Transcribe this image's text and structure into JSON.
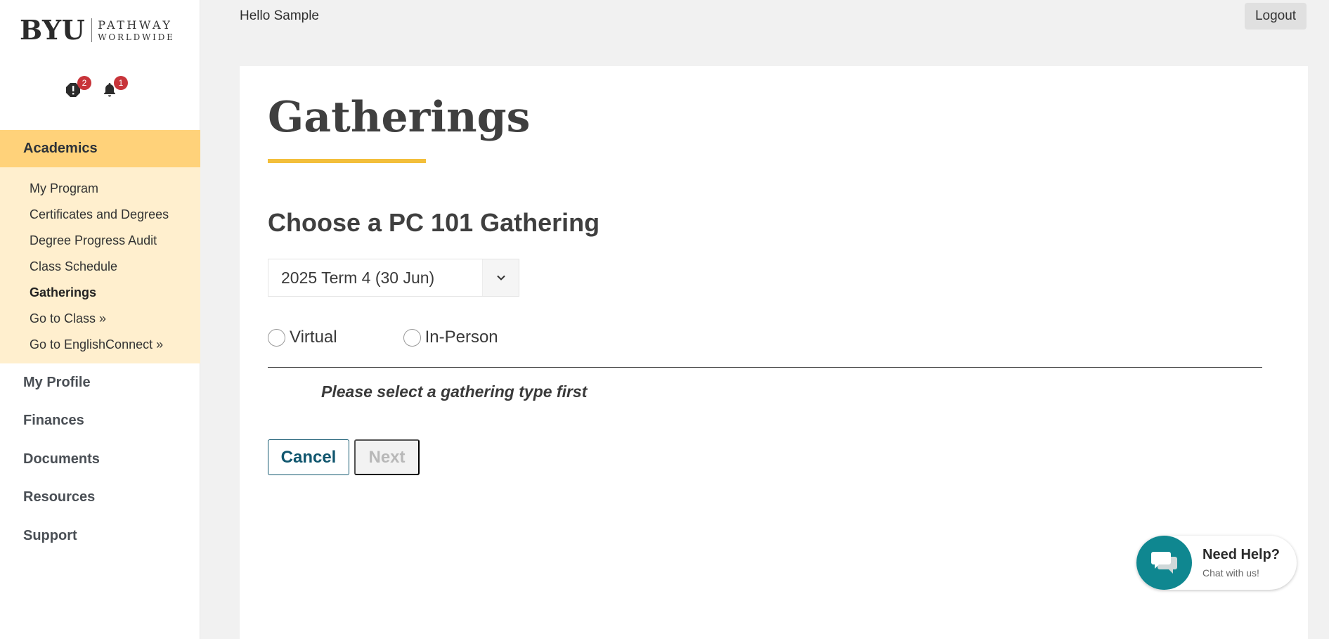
{
  "brand": {
    "logo_main": "BYU",
    "logo_line1": "PATHWAY",
    "logo_line2": "WORLDWIDE"
  },
  "notifications": {
    "alerts_count": "2",
    "bell_count": "1",
    "badge_color": "#c8343a"
  },
  "header": {
    "greeting": "Hello Sample",
    "logout_label": "Logout"
  },
  "sidebar": {
    "active_section": "Academics",
    "subitems": [
      {
        "label": "My Program"
      },
      {
        "label": "Certificates and Degrees"
      },
      {
        "label": "Degree Progress Audit"
      },
      {
        "label": "Class Schedule"
      },
      {
        "label": "Gatherings"
      },
      {
        "label": "Go to Class »"
      },
      {
        "label": "Go to EnglishConnect »"
      }
    ],
    "items": [
      {
        "label": "My Profile"
      },
      {
        "label": "Finances"
      },
      {
        "label": "Documents"
      },
      {
        "label": "Resources"
      },
      {
        "label": "Support"
      }
    ],
    "accent_color": "#ffd27a",
    "subnav_color": "#ffefce"
  },
  "main": {
    "page_title": "Gatherings",
    "section_title": "Choose a PC 101 Gathering",
    "term_select_value": "2025 Term 4 (30 Jun)",
    "radio_options": [
      {
        "label": "Virtual",
        "selected": false
      },
      {
        "label": "In-Person",
        "selected": false
      }
    ],
    "hint": "Please select a gathering type first",
    "cancel_label": "Cancel",
    "next_label": "Next",
    "title_underline_color": "#f3bf3b",
    "primary_color": "#10566e"
  },
  "help_widget": {
    "title": "Need Help?",
    "subtitle": "Chat with us!",
    "color": "#0f8790"
  }
}
